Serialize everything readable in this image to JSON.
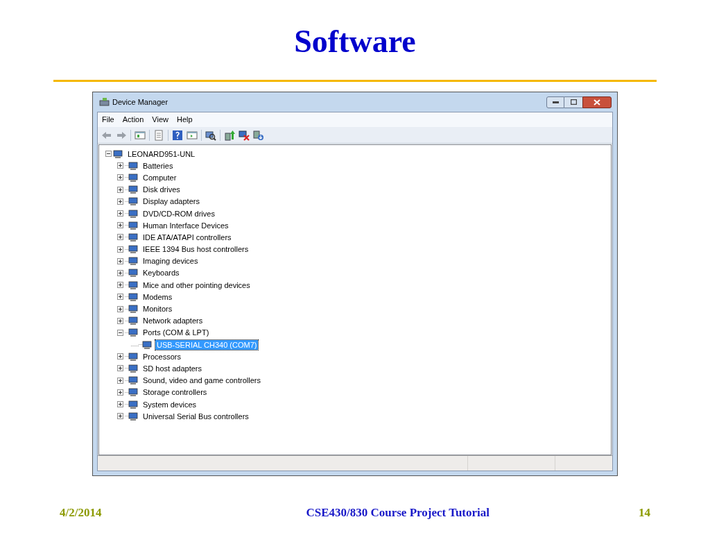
{
  "slide": {
    "title": "Software",
    "footer": {
      "date": "4/2/2014",
      "center": "CSE430/830 Course Project Tutorial",
      "page": "14"
    }
  },
  "window": {
    "title": "Device Manager"
  },
  "menu": [
    "File",
    "Action",
    "View",
    "Help"
  ],
  "tree": {
    "label": "LEONARD951-UNL",
    "expanded": true,
    "selected": false,
    "children": [
      {
        "label": "Batteries",
        "expanded": false,
        "selected": false
      },
      {
        "label": "Computer",
        "expanded": false,
        "selected": false
      },
      {
        "label": "Disk drives",
        "expanded": false,
        "selected": false
      },
      {
        "label": "Display adapters",
        "expanded": false,
        "selected": false
      },
      {
        "label": "DVD/CD-ROM drives",
        "expanded": false,
        "selected": false
      },
      {
        "label": "Human Interface Devices",
        "expanded": false,
        "selected": false
      },
      {
        "label": "IDE ATA/ATAPI controllers",
        "expanded": false,
        "selected": false
      },
      {
        "label": "IEEE 1394 Bus host controllers",
        "expanded": false,
        "selected": false
      },
      {
        "label": "Imaging devices",
        "expanded": false,
        "selected": false
      },
      {
        "label": "Keyboards",
        "expanded": false,
        "selected": false
      },
      {
        "label": "Mice and other pointing devices",
        "expanded": false,
        "selected": false
      },
      {
        "label": "Modems",
        "expanded": false,
        "selected": false
      },
      {
        "label": "Monitors",
        "expanded": false,
        "selected": false
      },
      {
        "label": "Network adapters",
        "expanded": false,
        "selected": false
      },
      {
        "label": "Ports (COM & LPT)",
        "expanded": true,
        "selected": false,
        "children": [
          {
            "label": "USB-SERIAL CH340 (COM7)",
            "selected": true
          }
        ]
      },
      {
        "label": "Processors",
        "expanded": false,
        "selected": false
      },
      {
        "label": "SD host adapters",
        "expanded": false,
        "selected": false
      },
      {
        "label": "Sound, video and game controllers",
        "expanded": false,
        "selected": false
      },
      {
        "label": "Storage controllers",
        "expanded": false,
        "selected": false
      },
      {
        "label": "System devices",
        "expanded": false,
        "selected": false
      },
      {
        "label": "Universal Serial Bus controllers",
        "expanded": false,
        "selected": false
      }
    ]
  }
}
